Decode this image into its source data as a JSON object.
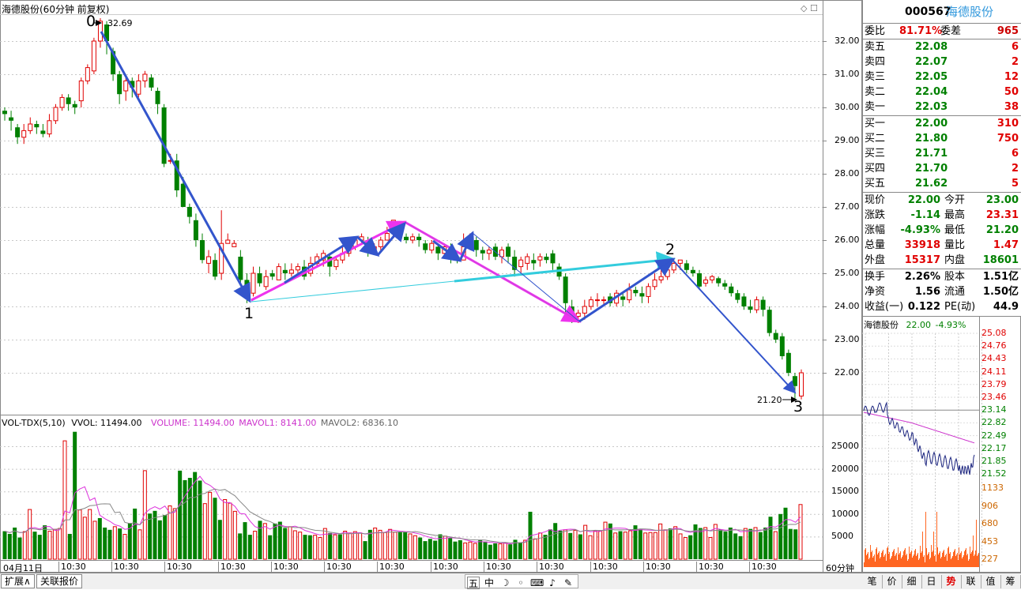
{
  "chart": {
    "title": "海德股份(60分钟 前复权)",
    "high_label": "32.69",
    "low_label": "21.20",
    "wave_points": [
      "0",
      "1",
      "2",
      "3"
    ],
    "price_ticks": [
      "32.00",
      "31.00",
      "30.00",
      "29.00",
      "28.00",
      "27.00",
      "26.00",
      "25.00",
      "24.00",
      "23.00",
      "22.00"
    ],
    "vol_ticks": [
      "25000",
      "20000",
      "15000",
      "10000",
      "5000"
    ],
    "date_label": "04月11日",
    "time_label": "10:30",
    "period_label": "60分钟",
    "vol_header": {
      "indicator": "VOL-TDX(5,10)",
      "vvol": "VVOL: 11494.00",
      "volume": "VOLUME: 11494.00",
      "mavol1": "MAVOL1: 8141.00",
      "mavol2": "MAVOL2: 6836.10"
    },
    "colors": {
      "up": "#e00000",
      "down": "#008000",
      "arrow_blue": "#3355cc",
      "arrow_magenta": "#ee33ee",
      "arrow_cyan": "#33ccdd"
    }
  },
  "chart_data": {
    "type": "candlestick",
    "ylim": [
      21.0,
      32.8
    ],
    "candles": [
      [
        29.9,
        29.8,
        30.0,
        29.6
      ],
      [
        29.7,
        29.6,
        29.9,
        29.3
      ],
      [
        29.4,
        29.1,
        29.5,
        28.9
      ],
      [
        29.1,
        29.3,
        29.5,
        28.9
      ],
      [
        29.3,
        29.5,
        29.7,
        29.2
      ],
      [
        29.5,
        29.4,
        29.6,
        29.2
      ],
      [
        29.3,
        29.2,
        29.5,
        29.1
      ],
      [
        29.2,
        29.6,
        29.8,
        29.1
      ],
      [
        29.6,
        30.0,
        30.1,
        29.5
      ],
      [
        30.0,
        30.3,
        30.4,
        29.9
      ],
      [
        30.3,
        30.1,
        30.4,
        29.9
      ],
      [
        30.1,
        30.0,
        30.2,
        29.8
      ],
      [
        30.2,
        30.8,
        30.9,
        30.0
      ],
      [
        30.8,
        31.2,
        31.3,
        30.7
      ],
      [
        31.1,
        32.0,
        32.1,
        31.0
      ],
      [
        32.0,
        32.6,
        32.69,
        31.8
      ],
      [
        32.5,
        32.0,
        32.6,
        31.6
      ],
      [
        31.7,
        31.0,
        31.8,
        30.8
      ],
      [
        31.0,
        30.4,
        31.1,
        30.1
      ],
      [
        30.5,
        30.8,
        30.9,
        30.2
      ],
      [
        30.8,
        30.6,
        30.9,
        30.3
      ],
      [
        30.4,
        30.8,
        31.0,
        30.3
      ],
      [
        30.8,
        31.0,
        31.1,
        30.6
      ],
      [
        30.9,
        30.6,
        31.0,
        30.5
      ],
      [
        30.5,
        30.1,
        30.6,
        29.8
      ],
      [
        30.0,
        28.3,
        30.1,
        28.2
      ],
      [
        28.4,
        28.4,
        28.6,
        28.3
      ],
      [
        28.4,
        27.5,
        28.6,
        27.3
      ],
      [
        27.7,
        27.0,
        27.9,
        27.0
      ],
      [
        27.0,
        26.7,
        27.1,
        26.5
      ],
      [
        26.6,
        26.0,
        26.8,
        25.8
      ],
      [
        26.0,
        25.4,
        26.2,
        25.3
      ],
      [
        25.3,
        25.5,
        25.7,
        25.0
      ],
      [
        25.4,
        24.9,
        25.6,
        24.8
      ],
      [
        25.0,
        25.9,
        26.9,
        24.8
      ],
      [
        25.9,
        26.0,
        26.2,
        25.9
      ],
      [
        25.8,
        25.9,
        26.0,
        25.8
      ],
      [
        25.5,
        24.8,
        25.7,
        24.7
      ],
      [
        24.8,
        24.4,
        25.0,
        24.1
      ],
      [
        24.4,
        25.0,
        25.2,
        24.3
      ],
      [
        25.0,
        24.7,
        25.2,
        24.6
      ],
      [
        24.6,
        24.9,
        25.1,
        24.5
      ],
      [
        25.0,
        24.9,
        25.1,
        24.8
      ],
      [
        24.8,
        25.2,
        25.3,
        24.8
      ],
      [
        25.1,
        25.0,
        25.3,
        24.8
      ],
      [
        25.0,
        25.1,
        25.3,
        24.9
      ],
      [
        25.1,
        25.2,
        25.3,
        25.0
      ],
      [
        25.2,
        24.9,
        25.4,
        24.8
      ],
      [
        25.0,
        25.3,
        25.5,
        24.9
      ],
      [
        25.3,
        25.5,
        25.6,
        25.2
      ],
      [
        25.4,
        25.6,
        25.7,
        25.2
      ],
      [
        25.5,
        25.2,
        25.6,
        24.9
      ],
      [
        25.2,
        25.4,
        25.5,
        25.1
      ],
      [
        25.4,
        25.6,
        25.8,
        25.3
      ],
      [
        25.6,
        25.8,
        25.9,
        25.5
      ],
      [
        25.8,
        26.0,
        26.1,
        25.7
      ],
      [
        26.0,
        26.1,
        26.2,
        25.9
      ],
      [
        26.0,
        25.7,
        26.1,
        25.5
      ],
      [
        25.7,
        25.8,
        25.9,
        25.6
      ],
      [
        25.8,
        26.0,
        26.1,
        25.7
      ],
      [
        26.0,
        26.2,
        26.4,
        26.0
      ],
      [
        26.2,
        26.6,
        26.6,
        26.1
      ],
      [
        26.1,
        26.1,
        26.2,
        26.0
      ],
      [
        26.1,
        26.0,
        26.2,
        25.9
      ],
      [
        26.0,
        26.1,
        26.2,
        25.9
      ],
      [
        26.1,
        26.0,
        26.2,
        25.8
      ],
      [
        25.9,
        25.7,
        26.0,
        25.6
      ],
      [
        25.7,
        25.9,
        26.0,
        25.6
      ],
      [
        25.8,
        25.6,
        25.9,
        25.4
      ],
      [
        25.6,
        25.8,
        25.9,
        25.5
      ],
      [
        25.8,
        25.5,
        25.9,
        25.3
      ],
      [
        25.5,
        25.4,
        25.6,
        25.3
      ],
      [
        25.4,
        25.8,
        26.2,
        25.4
      ],
      [
        25.8,
        26.1,
        26.2,
        25.7
      ],
      [
        26.0,
        25.7,
        26.1,
        25.5
      ],
      [
        25.7,
        25.6,
        25.8,
        25.4
      ],
      [
        25.6,
        25.7,
        25.8,
        25.4
      ],
      [
        25.8,
        25.5,
        25.9,
        25.4
      ],
      [
        25.5,
        25.7,
        25.8,
        25.3
      ],
      [
        25.8,
        25.5,
        25.9,
        25.3
      ],
      [
        25.5,
        25.1,
        25.7,
        24.9
      ],
      [
        25.2,
        25.4,
        25.5,
        25.0
      ],
      [
        25.3,
        25.5,
        25.6,
        25.1
      ],
      [
        25.4,
        25.3,
        25.6,
        25.1
      ],
      [
        25.4,
        25.5,
        25.6,
        25.2
      ],
      [
        25.5,
        25.4,
        25.6,
        25.3
      ],
      [
        25.6,
        25.3,
        25.7,
        25.1
      ],
      [
        25.2,
        24.9,
        25.3,
        24.8
      ],
      [
        24.9,
        24.1,
        25.0,
        23.8
      ],
      [
        24.0,
        23.7,
        24.2,
        23.5
      ],
      [
        23.7,
        23.8,
        23.9,
        23.5
      ],
      [
        23.8,
        24.0,
        24.2,
        23.6
      ],
      [
        24.0,
        24.2,
        24.3,
        23.9
      ],
      [
        24.2,
        24.2,
        24.4,
        24.0
      ],
      [
        24.2,
        24.2,
        24.3,
        24.0
      ],
      [
        24.3,
        24.1,
        24.4,
        24.0
      ],
      [
        24.1,
        24.4,
        24.5,
        24.0
      ],
      [
        24.3,
        24.2,
        24.4,
        24.0
      ],
      [
        24.2,
        24.5,
        24.7,
        24.1
      ],
      [
        24.5,
        24.4,
        24.6,
        24.3
      ],
      [
        24.4,
        24.3,
        24.6,
        24.1
      ],
      [
        24.3,
        24.6,
        24.7,
        24.1
      ],
      [
        24.6,
        24.8,
        25.0,
        24.5
      ],
      [
        24.8,
        24.9,
        25.1,
        24.7
      ],
      [
        24.9,
        25.1,
        25.2,
        24.8
      ],
      [
        25.1,
        25.3,
        25.4,
        25.0
      ],
      [
        25.3,
        25.4,
        25.4,
        25.1
      ],
      [
        25.3,
        25.1,
        25.4,
        25.0
      ],
      [
        25.1,
        25.0,
        25.2,
        24.9
      ],
      [
        25.0,
        24.6,
        25.1,
        24.5
      ],
      [
        24.7,
        24.8,
        24.9,
        24.6
      ],
      [
        24.8,
        24.9,
        24.95,
        24.7
      ],
      [
        24.85,
        24.7,
        24.9,
        24.6
      ],
      [
        24.7,
        24.6,
        24.8,
        24.5
      ],
      [
        24.6,
        24.4,
        24.7,
        24.3
      ],
      [
        24.4,
        24.2,
        24.5,
        24.1
      ],
      [
        24.3,
        24.0,
        24.4,
        23.9
      ],
      [
        24.0,
        23.9,
        24.2,
        23.8
      ],
      [
        23.9,
        24.2,
        24.3,
        23.8
      ],
      [
        24.2,
        23.9,
        24.3,
        23.7
      ],
      [
        23.9,
        23.2,
        24.0,
        23.1
      ],
      [
        23.2,
        23.0,
        23.3,
        22.9
      ],
      [
        23.1,
        22.5,
        23.2,
        22.4
      ],
      [
        22.6,
        22.0,
        22.7,
        21.9
      ],
      [
        21.9,
        21.6,
        22.0,
        21.2
      ],
      [
        21.3,
        22.0,
        22.1,
        21.2
      ]
    ],
    "volume": [
      6200,
      5600,
      7000,
      4800,
      6100,
      11000,
      6100,
      5400,
      7500,
      6200,
      6600,
      6800,
      26200,
      5600,
      28200,
      10900,
      9300,
      11000,
      8400,
      9100,
      7000,
      6500,
      7200,
      6800,
      5500,
      8000,
      11200,
      6500,
      19600,
      10100,
      10700,
      8600,
      9800,
      11800,
      11200,
      19600,
      17500,
      18000,
      19300,
      17400,
      12300,
      14800,
      13600,
      8700,
      13200,
      12400,
      10600,
      5700,
      8200,
      5400,
      6200,
      8500,
      7900,
      5300,
      7900,
      8300,
      6900,
      7200,
      6300,
      6000,
      5400,
      5300,
      5300,
      4800,
      6800,
      5800,
      5400,
      5500,
      6200,
      5800,
      6100,
      5800,
      4000,
      6500,
      6900,
      6400,
      5900,
      6600,
      6000,
      6100,
      6000,
      5600,
      5200,
      4800,
      4000,
      4500,
      4100,
      5500,
      5100,
      4700,
      3900,
      4200,
      3600,
      3800,
      3500,
      4300,
      3900,
      3200,
      3500,
      3400,
      3600,
      3300,
      4300,
      3700,
      4200,
      10500,
      4500,
      5800,
      5400,
      6600,
      8000,
      6300,
      6500,
      5800,
      6400,
      5500,
      7500,
      5200,
      6200,
      6300,
      8200,
      7900,
      5800,
      6200,
      6000,
      6300,
      7500,
      6700,
      5800,
      5900,
      5900,
      7800,
      6500,
      6800,
      7200,
      5600,
      4800,
      5300,
      7700,
      6900,
      7000,
      4800,
      7700,
      6600,
      6100,
      7000,
      5700,
      5100,
      6800,
      6700,
      7000,
      6000,
      7000,
      9400,
      6100,
      10000,
      11400,
      6700,
      6600,
      12100
    ]
  },
  "panel": {
    "code": "000567",
    "name": "海德股份",
    "weibi": {
      "label": "委比",
      "value": "81.71%",
      "label2": "委差",
      "value2": "965"
    },
    "sells": [
      {
        "label": "卖五",
        "price": "22.08",
        "qty": "6"
      },
      {
        "label": "卖四",
        "price": "22.07",
        "qty": "2"
      },
      {
        "label": "卖三",
        "price": "22.05",
        "qty": "12"
      },
      {
        "label": "卖二",
        "price": "22.04",
        "qty": "50"
      },
      {
        "label": "卖一",
        "price": "22.03",
        "qty": "38"
      }
    ],
    "buys": [
      {
        "label": "买一",
        "price": "22.00",
        "qty": "310"
      },
      {
        "label": "买二",
        "price": "21.80",
        "qty": "750"
      },
      {
        "label": "买三",
        "price": "21.71",
        "qty": "6"
      },
      {
        "label": "买四",
        "price": "21.70",
        "qty": "2"
      },
      {
        "label": "买五",
        "price": "21.62",
        "qty": "5"
      }
    ],
    "quote": [
      {
        "l1": "现价",
        "v1": "22.00",
        "c1": "grn",
        "l2": "今开",
        "v2": "23.00",
        "c2": "grn"
      },
      {
        "l1": "涨跌",
        "v1": "-1.14",
        "c1": "grn",
        "l2": "最高",
        "v2": "23.31",
        "c2": "red"
      },
      {
        "l1": "涨幅",
        "v1": "-4.93%",
        "c1": "grn",
        "l2": "最低",
        "v2": "21.20",
        "c2": "grn"
      },
      {
        "l1": "总量",
        "v1": "33918",
        "c1": "red",
        "l2": "量比",
        "v2": "1.47",
        "c2": "red"
      },
      {
        "l1": "外盘",
        "v1": "15317",
        "c1": "red",
        "l2": "内盘",
        "v2": "18601",
        "c2": "grn"
      }
    ],
    "fund": [
      {
        "l1": "换手",
        "v1": "2.26%",
        "l2": "股本",
        "v2": "1.51亿"
      },
      {
        "l1": "净资",
        "v1": "1.56",
        "l2": "流通",
        "v2": "1.50亿"
      },
      {
        "l1": "收益(一)",
        "v1": "0.122",
        "l2": "PE(动)",
        "v2": "44.9"
      }
    ],
    "mini": {
      "title": "海德股份",
      "price": "22.00",
      "change": "-4.93%",
      "price_ticks": [
        "25.08",
        "24.76",
        "24.43",
        "24.11",
        "23.79",
        "23.46",
        "23.14",
        "22.82",
        "22.49",
        "22.17",
        "21.85",
        "21.52"
      ],
      "vol_ticks": [
        "1133",
        "906",
        "680",
        "453",
        "227"
      ]
    }
  },
  "bottom": {
    "tab_expand": "扩展∧",
    "tab_related": "关联报价",
    "right_tabs": [
      "笔",
      "价",
      "细",
      "日",
      "势",
      "联",
      "值",
      "筹"
    ],
    "tools": [
      "五",
      "中",
      "☽",
      "◦",
      "⌨",
      "♪",
      "✎"
    ]
  }
}
